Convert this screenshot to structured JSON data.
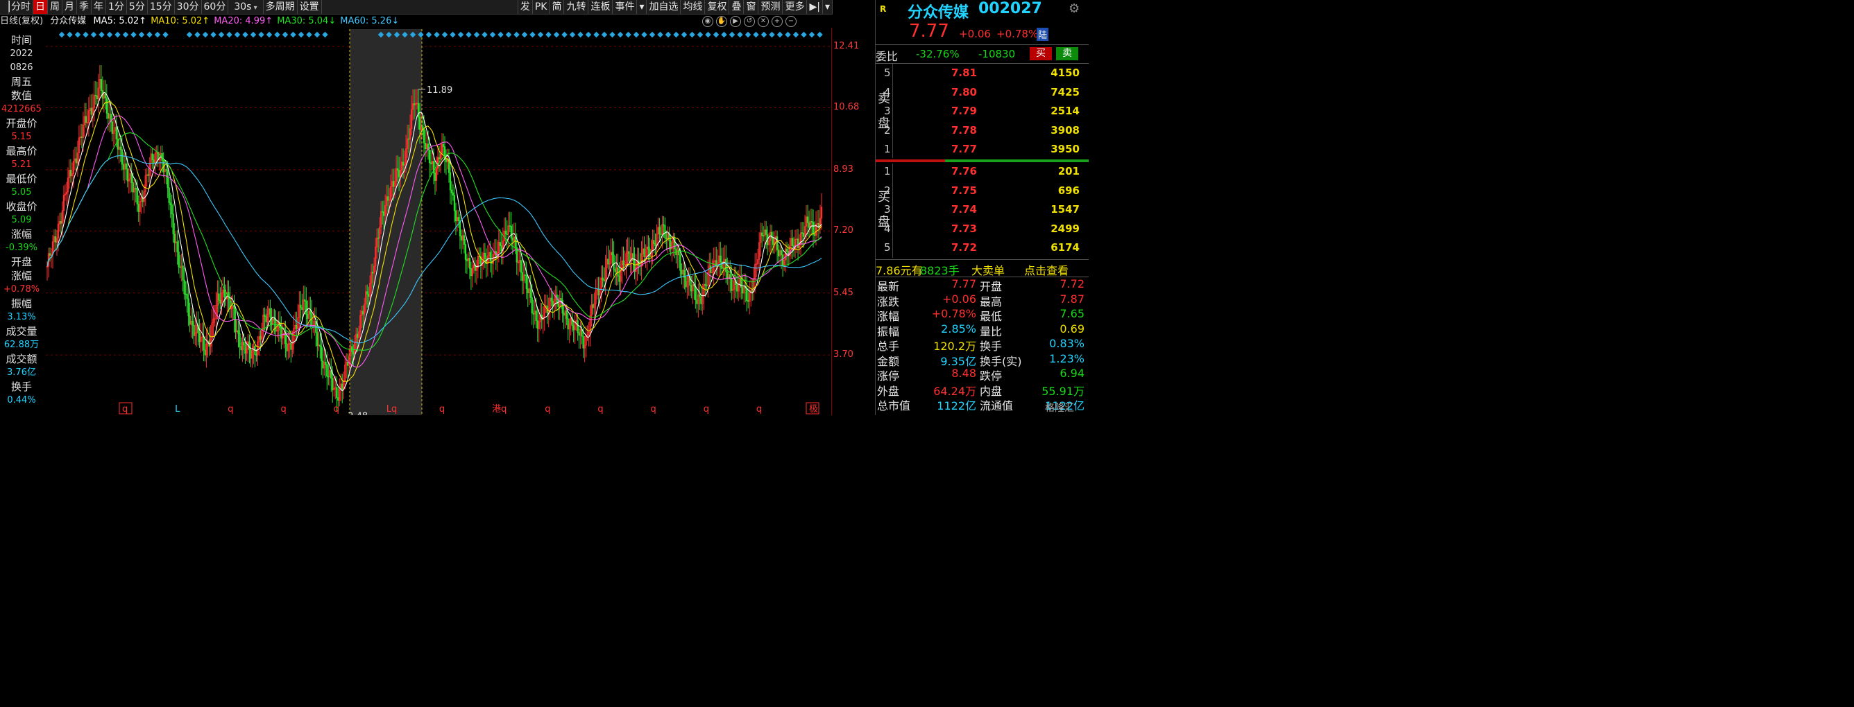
{
  "toolbar": {
    "left_items": [
      "分时",
      "日",
      "周",
      "月",
      "季",
      "年",
      "1分",
      "5分",
      "15分",
      "30分",
      "60分"
    ],
    "active": "日",
    "interval_select": "30s",
    "mid_items": [
      "多周期",
      "设置"
    ],
    "right_items": [
      "发",
      "PK",
      "简",
      "九转",
      "连板",
      "事件",
      "加自选",
      "均线",
      "复权",
      "叠",
      "窗",
      "预测",
      "更多"
    ]
  },
  "indicator": {
    "period": "日线(复权)",
    "stock_name": "分众传媒",
    "ma": [
      {
        "label": "MA5: 5.02↑",
        "color": "#ffffff"
      },
      {
        "label": "MA10: 5.02↑",
        "color": "#f5e000"
      },
      {
        "label": "MA20: 4.99↑",
        "color": "#ff5cf5"
      },
      {
        "label": "MA30: 5.04↓",
        "color": "#22e022"
      },
      {
        "label": "MA60: 5.26↓",
        "color": "#3ec8ff"
      }
    ]
  },
  "left_column": [
    {
      "t": "时间",
      "c": "#e0e0e0"
    },
    {
      "t": "2022",
      "c": "#e0e0e0",
      "v": true
    },
    {
      "t": "0826",
      "c": "#e0e0e0",
      "v": true
    },
    {
      "t": "周五",
      "c": "#e0e0e0"
    },
    {
      "t": "数值",
      "c": "#e0e0e0"
    },
    {
      "t": "4212665",
      "c": "#ff3030",
      "v": true
    },
    {
      "t": "开盘价",
      "c": "#e0e0e0"
    },
    {
      "t": "5.15",
      "c": "#ff3030",
      "v": true
    },
    {
      "t": "最高价",
      "c": "#e0e0e0"
    },
    {
      "t": "5.21",
      "c": "#ff3030",
      "v": true
    },
    {
      "t": "最低价",
      "c": "#e0e0e0"
    },
    {
      "t": "5.05",
      "c": "#18d818",
      "v": true
    },
    {
      "t": "收盘价",
      "c": "#e0e0e0"
    },
    {
      "t": "5.09",
      "c": "#18d818",
      "v": true
    },
    {
      "t": "涨幅",
      "c": "#e0e0e0"
    },
    {
      "t": "-0.39%",
      "c": "#18d818",
      "v": true
    },
    {
      "t": "开盘",
      "c": "#e0e0e0"
    },
    {
      "t": "涨幅",
      "c": "#e0e0e0"
    },
    {
      "t": "+0.78%",
      "c": "#ff3030",
      "v": true
    },
    {
      "t": "振幅",
      "c": "#e0e0e0"
    },
    {
      "t": "3.13%",
      "c": "#21d3ff",
      "v": true
    },
    {
      "t": "成交量",
      "c": "#e0e0e0"
    },
    {
      "t": "62.88万",
      "c": "#21d3ff",
      "v": true
    },
    {
      "t": "成交额",
      "c": "#e0e0e0"
    },
    {
      "t": "3.76亿",
      "c": "#21d3ff",
      "v": true
    },
    {
      "t": "换手",
      "c": "#e0e0e0"
    },
    {
      "t": "0.44%",
      "c": "#21d3ff",
      "v": true
    }
  ],
  "chart_data": {
    "type": "line",
    "y_ticks": [
      "12.41",
      "10.68",
      "8.93",
      "7.20",
      "5.45",
      "3.70"
    ],
    "ylim": [
      2.0,
      12.9
    ],
    "series_close": [
      6.2,
      6.8,
      7.6,
      8.4,
      9.1,
      9.8,
      10.3,
      10.9,
      11.2,
      10.8,
      10.1,
      9.4,
      9.0,
      8.4,
      7.9,
      8.6,
      9.2,
      9.5,
      8.8,
      7.6,
      6.4,
      5.4,
      4.6,
      4.2,
      3.9,
      4.3,
      5.2,
      5.6,
      5.0,
      4.3,
      3.9,
      3.7,
      4.0,
      4.6,
      4.9,
      4.5,
      4.1,
      4.0,
      4.5,
      5.3,
      4.8,
      4.2,
      3.6,
      3.0,
      2.6,
      2.9,
      3.6,
      4.2,
      4.8,
      5.6,
      6.6,
      7.6,
      8.3,
      8.6,
      9.0,
      9.8,
      10.9,
      10.2,
      9.3,
      8.8,
      9.6,
      9.0,
      8.0,
      7.0,
      6.4,
      6.1,
      6.3,
      6.6,
      6.3,
      6.8,
      7.3,
      6.9,
      6.3,
      5.6,
      5.0,
      4.6,
      4.9,
      5.4,
      5.1,
      4.8,
      4.6,
      4.3,
      4.1,
      4.9,
      5.6,
      6.1,
      6.4,
      6.0,
      6.3,
      6.5,
      6.2,
      6.5,
      6.8,
      7.0,
      7.3,
      6.9,
      6.5,
      6.0,
      5.6,
      5.3,
      5.5,
      6.0,
      6.5,
      6.2,
      5.8,
      5.7,
      5.5,
      5.4,
      6.1,
      7.3,
      7.0,
      6.8,
      6.5,
      6.6,
      6.9,
      7.1,
      7.4,
      7.3,
      7.6
    ],
    "highlights": [
      {
        "label": "11.89"
      },
      {
        "label": "2.48"
      }
    ],
    "bottom_marks": [
      {
        "text": "q",
        "color": "#ff3030",
        "boxed": true
      },
      {
        "text": "L",
        "color": "#21d3ff"
      },
      {
        "text": "q",
        "color": "#ff3030"
      },
      {
        "text": "q",
        "color": "#ff3030"
      },
      {
        "text": "q",
        "color": "#ff3030"
      },
      {
        "text": "Lq",
        "color": "#ff3030"
      },
      {
        "text": "q",
        "color": "#ff3030"
      },
      {
        "text": "港q",
        "color": "#ff3030"
      },
      {
        "text": "q",
        "color": "#ff3030"
      },
      {
        "text": "q",
        "color": "#ff3030"
      },
      {
        "text": "q",
        "color": "#ff3030"
      },
      {
        "text": "q",
        "color": "#ff3030"
      },
      {
        "text": "q",
        "color": "#ff3030"
      },
      {
        "text": "极",
        "color": "#ff3030",
        "boxed": true
      }
    ]
  },
  "quote": {
    "tag": "R",
    "name": "分众传媒",
    "code": "002027",
    "price": "7.77",
    "change": "+0.06",
    "pct": "+0.78%",
    "lu": "陆",
    "weibi_label": "委比",
    "weibi": "-32.76%",
    "weicha": "-10830",
    "buy_btn": "买",
    "sell_btn": "卖",
    "sell_label": [
      "卖",
      "盘"
    ],
    "buy_label": [
      "买",
      "盘"
    ],
    "asks": [
      {
        "n": "5",
        "p": "7.81",
        "v": "4150"
      },
      {
        "n": "4",
        "p": "7.80",
        "v": "7425"
      },
      {
        "n": "3",
        "p": "7.79",
        "v": "2514"
      },
      {
        "n": "2",
        "p": "7.78",
        "v": "3908"
      },
      {
        "n": "1",
        "p": "7.77",
        "v": "3950"
      }
    ],
    "bids": [
      {
        "n": "1",
        "p": "7.76",
        "v": "201"
      },
      {
        "n": "2",
        "p": "7.75",
        "v": "696"
      },
      {
        "n": "3",
        "p": "7.74",
        "v": "1547"
      },
      {
        "n": "4",
        "p": "7.73",
        "v": "2499"
      },
      {
        "n": "5",
        "p": "7.72",
        "v": "6174"
      }
    ],
    "big_order": {
      "price": "7.86元有",
      "qty": "8823手",
      "label": "大卖单",
      "link": "点击查看"
    },
    "stats": [
      {
        "l": "最新",
        "v": "7.77",
        "c": "red",
        "l2": "开盘",
        "v2": "7.72",
        "c2": "red"
      },
      {
        "l": "涨跌",
        "v": "+0.06",
        "c": "red",
        "l2": "最高",
        "v2": "7.87",
        "c2": "red"
      },
      {
        "l": "涨幅",
        "v": "+0.78%",
        "c": "red",
        "l2": "最低",
        "v2": "7.65",
        "c2": "green"
      },
      {
        "l": "振幅",
        "v": "2.85%",
        "c": "cyan",
        "l2": "量比",
        "v2": "0.69",
        "c2": "yellow"
      },
      {
        "l": "总手",
        "v": "120.2万",
        "c": "yellow",
        "l2": "换手",
        "v2": "0.83%",
        "c2": "cyan"
      },
      {
        "l": "金额",
        "v": "9.35亿",
        "c": "cyan",
        "l2": "换手(实)",
        "v2": "1.23%",
        "c2": "cyan"
      },
      {
        "l": "涨停",
        "v": "8.48",
        "c": "red",
        "l2": "跌停",
        "v2": "6.94",
        "c2": "green"
      },
      {
        "l": "外盘",
        "v": "64.24万",
        "c": "red",
        "l2": "内盘",
        "v2": "55.91万",
        "c2": "green"
      },
      {
        "l": "总市值",
        "v": "1122亿",
        "c": "cyan",
        "l2": "流通值",
        "v2": "1122亿",
        "c2": "cyan"
      }
    ],
    "brand": "格隆汇"
  }
}
